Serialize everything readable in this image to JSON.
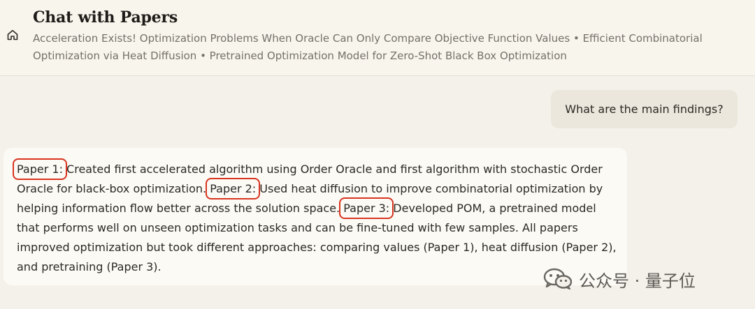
{
  "header": {
    "home_icon": "home-icon",
    "title": "Chat with Papers",
    "papers": "Acceleration Exists! Optimization Problems When Oracle Can Only Compare Objective Function Values • Efficient Combinatorial Optimization via Heat Diffusion • Pretrained Optimization Model for Zero-Shot Black Box Optimization"
  },
  "chat": {
    "user_message": "What are the main findings?",
    "assistant": {
      "ref1": "Paper 1:",
      "text1": " Created first accelerated algorithm using Order Oracle and first algorithm with stochastic Order Oracle for black-box optimization.",
      "ref2": "Paper 2:",
      "text2": " Used heat diffusion to improve combinatorial optimization by helping information flow better across the solution space.",
      "ref3": "Paper 3:",
      "text3": " Developed POM, a pretrained model that performs well on unseen optimization tasks and can be fine-tuned with few samples. All papers improved optimization but took different approaches: comparing values (Paper 1), heat diffusion (Paper 2), and pretraining (Paper 3)."
    }
  },
  "watermark": {
    "icon": "wechat-icon",
    "text": "公众号 · 量子位"
  },
  "colors": {
    "page_background": "#f4f1ea",
    "header_background": "#f8f5ed",
    "user_bubble": "#ebe7dc",
    "answer_card": "#fbfaf5",
    "highlight_box": "#d9341f"
  }
}
